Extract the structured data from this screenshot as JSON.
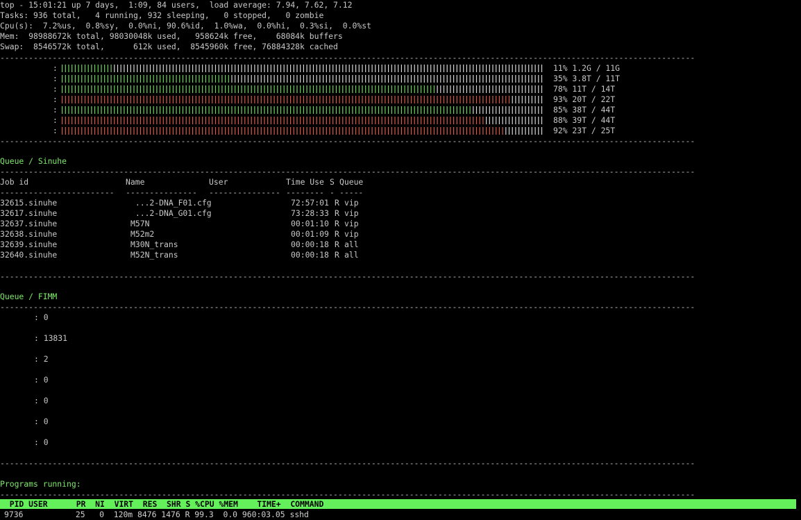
{
  "top": {
    "uptime": "top - 15:01:21 up 7 days,  1:09, 84 users,  load average: 7.94, 7.62, 7.12",
    "tasks": "Tasks: 936 total,   4 running, 932 sleeping,   0 stopped,   0 zombie",
    "cpu": "Cpu(s):  7.2%us,  0.8%sy,  0.0%ni, 90.6%id,  1.0%wa,  0.0%hi,  0.3%si,  0.0%st",
    "mem": "Mem:  98988672k total, 98030048k used,   958624k free,    68084k buffers",
    "swap": "Swap:  8546572k total,      612k used,  8545960k free, 76884328k cached"
  },
  "separator": "--------------------------------------------------------------------------------------------------------------------------------------------------",
  "usage_bars": [
    {
      "label": ":",
      "percent": 11,
      "text": "11% 1.2G / 11G",
      "color": "#6ed45c"
    },
    {
      "label": ":",
      "percent": 35,
      "text": "35% 3.8T / 11T",
      "color": "#6ed45c"
    },
    {
      "label": ":",
      "percent": 78,
      "text": "78% 11T / 14T",
      "color": "#6ed45c"
    },
    {
      "label": ":",
      "percent": 93,
      "text": "93% 20T / 22T",
      "color": "#d85a4a"
    },
    {
      "label": ":",
      "percent": 85,
      "text": "85% 38T / 44T",
      "color": "#6ed45c"
    },
    {
      "label": ":",
      "percent": 88,
      "text": "88% 39T / 44T",
      "color": "#d85a4a"
    },
    {
      "label": ":",
      "percent": 92,
      "text": "92% 23T / 25T",
      "color": "#d85a4a"
    }
  ],
  "queue_sinuhe": {
    "title": "Queue / Sinuhe",
    "headers": {
      "job": "Job id",
      "name": "Name",
      "user": "User",
      "time": "Time Use",
      "s": "S",
      "queue": "Queue"
    },
    "underline": {
      "job": "------------------------",
      "name": "---------------",
      "user": "---------------",
      "time": "--------",
      "s": "-",
      "queue": "-----"
    },
    "jobs": [
      {
        "id": "32615.sinuhe",
        "name": " ...2-DNA_F01.cfg",
        "time": "72:57:01",
        "s": "R",
        "queue": "vip"
      },
      {
        "id": "32617.sinuhe",
        "name": " ...2-DNA_G01.cfg",
        "time": "73:28:33",
        "s": "R",
        "queue": "vip"
      },
      {
        "id": "32637.sinuhe",
        "name": "M57N",
        "time": "00:01:10",
        "s": "R",
        "queue": "vip"
      },
      {
        "id": "32638.sinuhe",
        "name": "M52m2",
        "time": "00:01:09",
        "s": "R",
        "queue": "vip"
      },
      {
        "id": "32639.sinuhe",
        "name": "M30N_trans",
        "time": "00:00:18",
        "s": "R",
        "queue": "all"
      },
      {
        "id": "32640.sinuhe",
        "name": "M52N_trans",
        "time": "00:00:18",
        "s": "R",
        "queue": "all"
      }
    ]
  },
  "queue_fimm": {
    "title": "Queue / FIMM",
    "items": [
      ": 0",
      ": 13831",
      ": 2",
      ": 0",
      ": 0",
      ": 0",
      ": 0"
    ]
  },
  "programs": {
    "title": "Programs running:",
    "header": "  PID USER      PR  NI  VIRT  RES  SHR S %CPU %MEM    TIME+  COMMAND",
    "row": "9736           25   0  120m 8476 1476 R 99.3  0.0 960:03.05 sshd"
  }
}
